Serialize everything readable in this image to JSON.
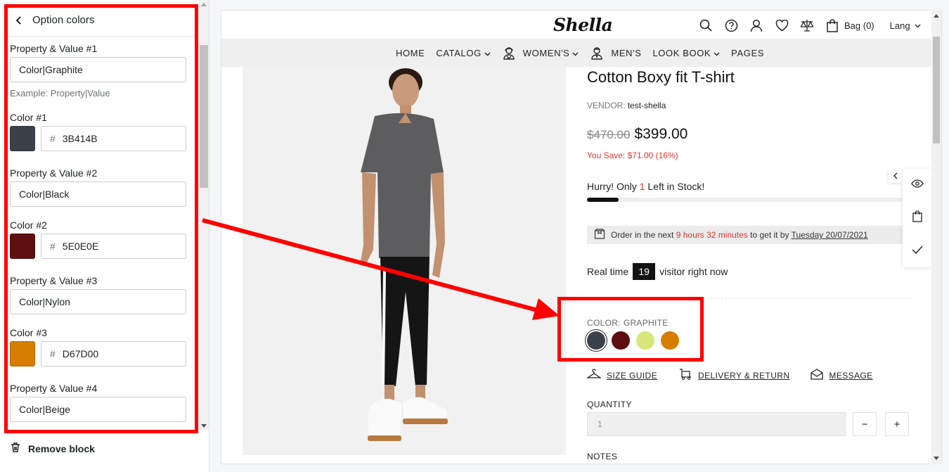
{
  "colors": {
    "highlight": "#ff0000",
    "sale_red": "#e3342f",
    "graphite": "#3B414B",
    "black": "#5E0E0E",
    "nylon": "#D67D00"
  },
  "settings_panel": {
    "title": "Option colors",
    "back_icon": "chevron-left-icon",
    "fields": [
      {
        "label": "Property & Value #1",
        "value": "Color|Graphite",
        "help": "Example: Property|Value"
      },
      {
        "label": "Color #1",
        "hash": "#",
        "hex": "3B414B",
        "swatch": "#3B414B"
      },
      {
        "label": "Property & Value #2",
        "value": "Color|Black"
      },
      {
        "label": "Color #2",
        "hash": "#",
        "hex": "5E0E0E",
        "swatch": "#5E0E0E"
      },
      {
        "label": "Property & Value #3",
        "value": "Color|Nylon"
      },
      {
        "label": "Color #3",
        "hash": "#",
        "hex": "D67D00",
        "swatch": "#D67D00"
      },
      {
        "label": "Property & Value #4",
        "value": "Color|Beige"
      }
    ],
    "remove_block": "Remove block",
    "remove_icon": "trash-icon"
  },
  "store": {
    "logo": "Shella",
    "header": {
      "icons": [
        "search-icon",
        "help-icon",
        "account-icon",
        "wishlist-icon",
        "compare-icon",
        "bag-icon"
      ],
      "bag": "Bag (0)",
      "lang": "Lang"
    },
    "nav": [
      {
        "label": "HOME"
      },
      {
        "label": "CATALOG"
      },
      {
        "label": "WOMEN'S"
      },
      {
        "label": "MEN'S"
      },
      {
        "label": "LOOK BOOK"
      },
      {
        "label": "PAGES"
      }
    ],
    "product": {
      "title": "Cotton Boxy fit T-shirt",
      "vendor_label": "VENDOR:",
      "vendor": "test-shella",
      "price_old": "$470.00",
      "price_new": "$399.00",
      "you_save": "You Save: $71.00 (16%)",
      "stock_prefix": "Hurry! Only",
      "stock_count": "1",
      "stock_suffix": "Left in Stock!",
      "stock_level": 0.1,
      "delivery": {
        "prefix": "Order in the next",
        "time": "9 hours 32 minutes",
        "middle": "to get it by",
        "date": "Tuesday 20/07/2021"
      },
      "visitors": {
        "prefix": "Real time",
        "count": "19",
        "suffix": "visitor right now"
      },
      "color_label": "COLOR:",
      "color_value": "GRAPHITE",
      "swatches": [
        "#3B414B",
        "#5E0E0E",
        "#D9E67C",
        "#D67D00"
      ],
      "links": [
        "SIZE GUIDE",
        "DELIVERY & RETURN",
        "MESSAGE"
      ],
      "quantity_label": "QUANTITY",
      "quantity_value": "1",
      "minus": "−",
      "plus": "+",
      "notes_label": "NOTES"
    }
  }
}
